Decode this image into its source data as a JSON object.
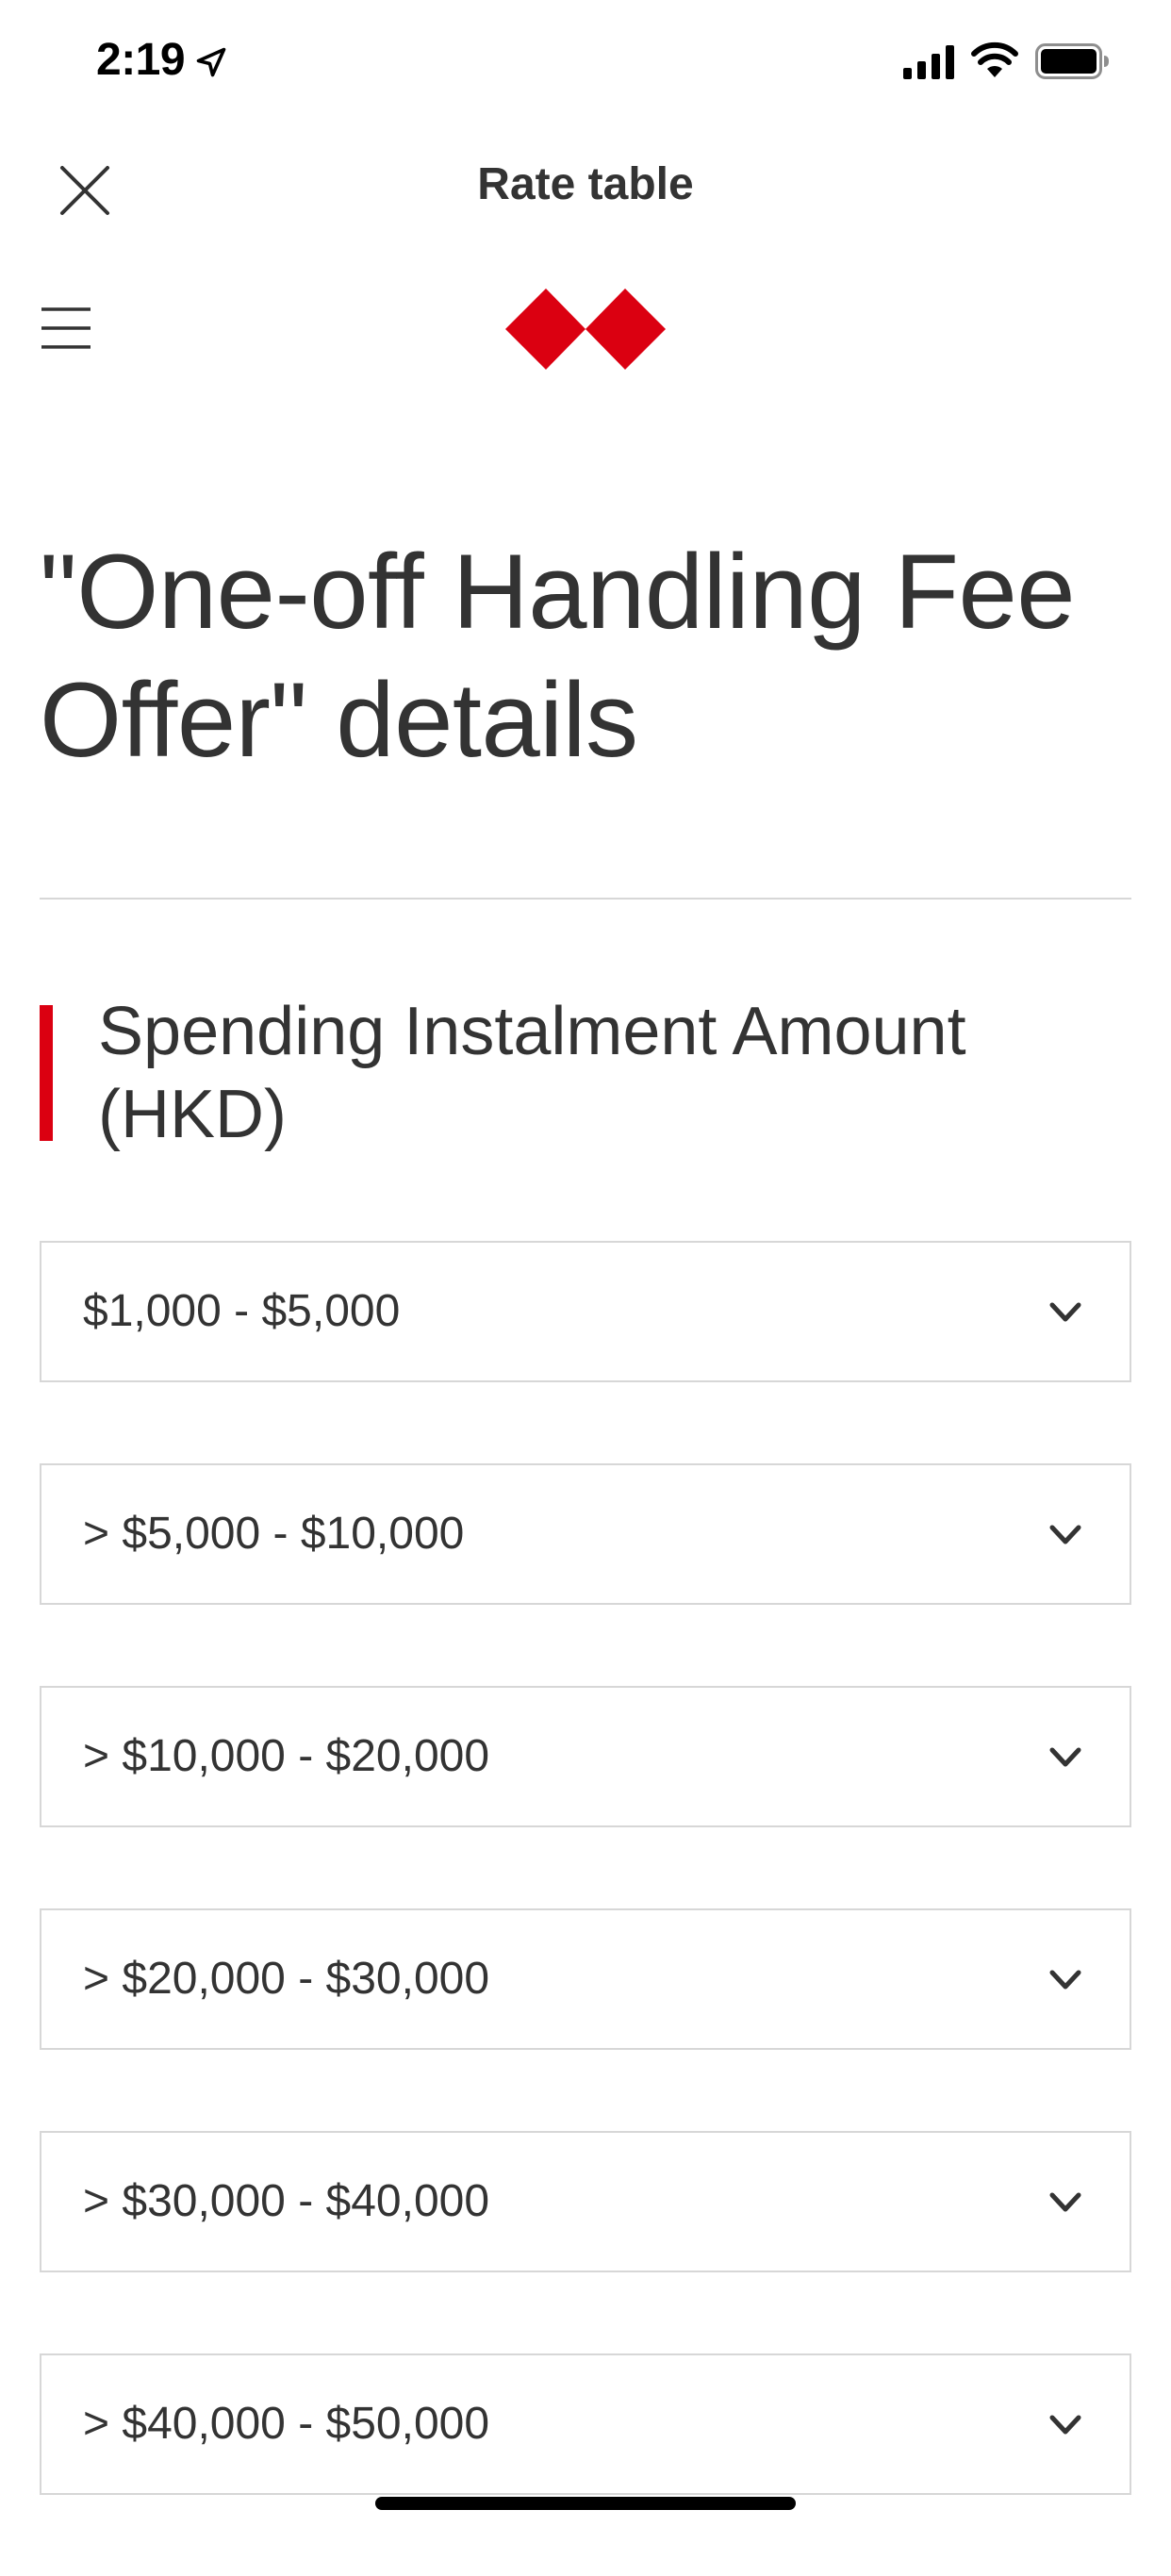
{
  "status_bar": {
    "time": "2:19"
  },
  "nav": {
    "title": "Rate table"
  },
  "page": {
    "title": "\"One-off Handling Fee Offer\" details",
    "section_title": "Spending Instalment Amount (HKD)"
  },
  "colors": {
    "brand_red": "#db0011",
    "text": "#333333",
    "border": "#d7d7d7"
  },
  "accordion": {
    "items": [
      {
        "label": "$1,000 - $5,000"
      },
      {
        "label": "> $5,000 - $10,000"
      },
      {
        "label": "> $10,000 - $20,000"
      },
      {
        "label": "> $20,000 - $30,000"
      },
      {
        "label": "> $30,000 - $40,000"
      },
      {
        "label": "> $40,000 - $50,000"
      }
    ]
  }
}
